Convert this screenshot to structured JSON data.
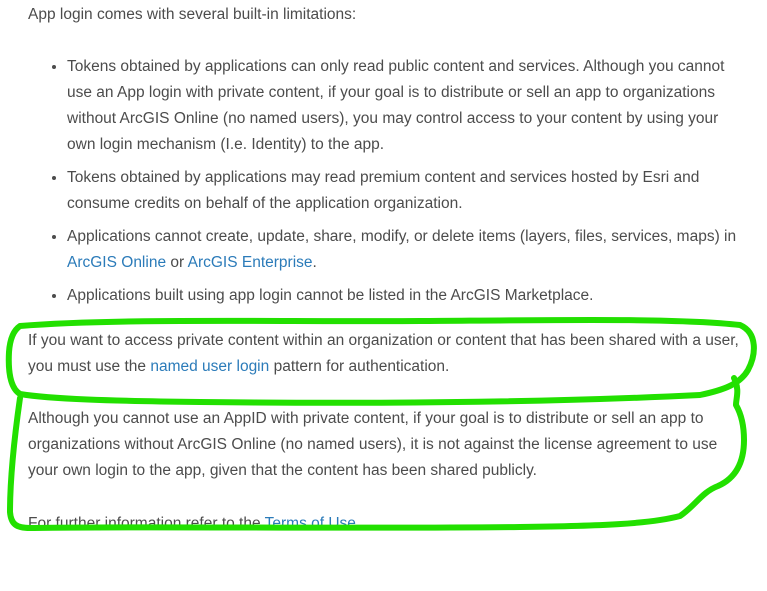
{
  "intro": "App login comes with several built-in limitations:",
  "bullets": {
    "b1": "Tokens obtained by applications can only read public content and services. Although you cannot use an App login with private content, if your goal is to distribute or sell an app to organizations without ArcGIS Online (no named users), you may control access to your content by using your own login mechanism (I.e. Identity) to the app.",
    "b2": "Tokens obtained by applications may read premium content and services hosted by Esri and consume credits on behalf of the application organization.",
    "b3_pre": "Applications cannot create, update, share, modify, or delete items (layers, files, services, maps) in ",
    "b3_link1": "ArcGIS Online",
    "b3_mid": " or ",
    "b3_link2": "ArcGIS Enterprise",
    "b3_post": ".",
    "b4": "Applications built using app login cannot be listed in the ArcGIS Marketplace."
  },
  "para2": {
    "pre": "If you want to access private content within an organization or content that has been shared with a user, you must use the ",
    "link": "named user login",
    "post": " pattern for authentication."
  },
  "para3": "Although you cannot use an AppID with private content, if your goal is to distribute or sell an app to organizations without ArcGIS Online (no named users), it is not against the license agreement to use your own login to the app, given that the content has been shared publicly.",
  "para4": {
    "pre": "For further information refer to the ",
    "link": "Terms of Use",
    "post": "."
  },
  "colors": {
    "text": "#4c4c4c",
    "link": "#2b7bb9",
    "highlight": "#22e000"
  }
}
